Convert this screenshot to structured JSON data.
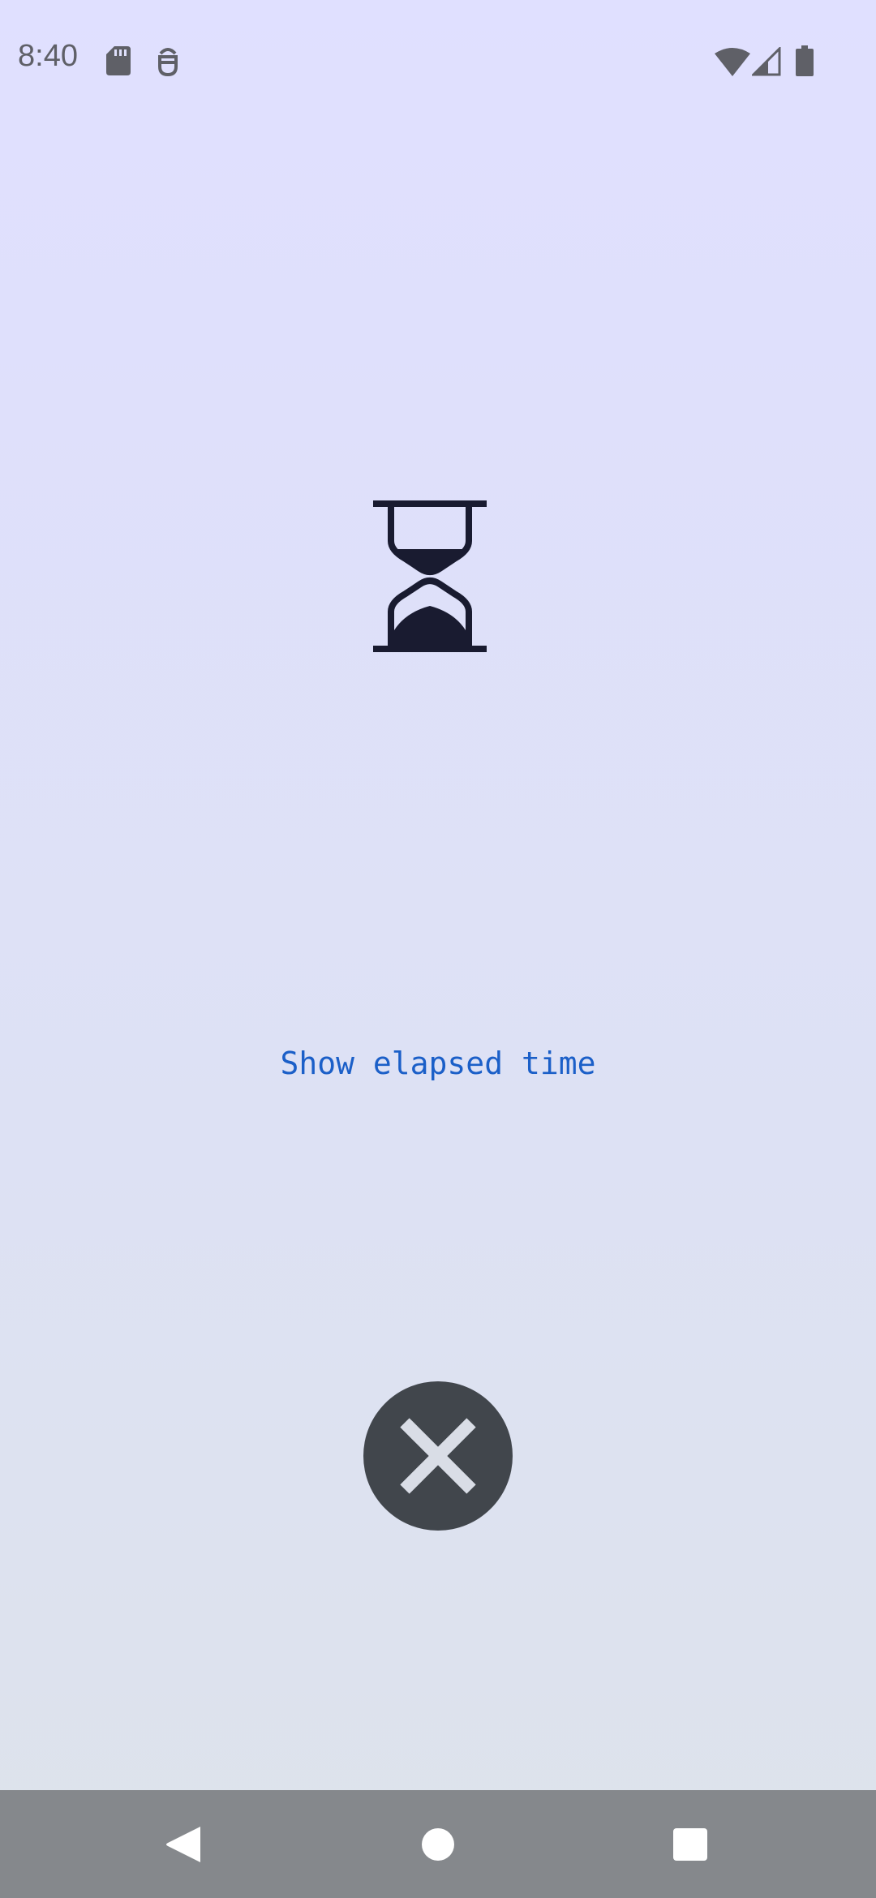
{
  "status_bar": {
    "time": "8:40",
    "left_icons": [
      "sd-card-icon",
      "bug-icon"
    ],
    "right_icons": [
      "wifi-icon",
      "signal-icon",
      "battery-icon"
    ],
    "icon_color": "#5f6067"
  },
  "main": {
    "illustration_icon": "hourglass-icon",
    "elapsed_link_label": "Show elapsed time",
    "link_color": "#1b5fc8",
    "close_icon": "close-icon",
    "close_button_color": "#41464c"
  },
  "nav_bar": {
    "buttons": [
      "back-icon",
      "home-icon",
      "recents-icon"
    ],
    "background": "#85888c"
  }
}
